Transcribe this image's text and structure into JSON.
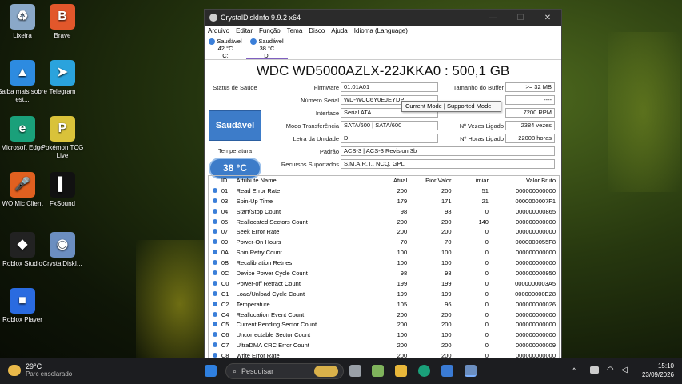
{
  "desktop": {
    "icons": [
      {
        "label": "Lixeira",
        "icon": "recycle-bin-icon",
        "color": "#8aa8c8",
        "glyph": "♻"
      },
      {
        "label": "Brave",
        "icon": "brave-icon",
        "color": "#e2572b",
        "glyph": "B"
      },
      {
        "label": "Saiba mais sobre est...",
        "icon": "learn-more-icon",
        "color": "#2d8be0",
        "glyph": "▲"
      },
      {
        "label": "Telegram",
        "icon": "telegram-icon",
        "color": "#2aa3dd",
        "glyph": "➤"
      },
      {
        "label": "Microsoft Edge",
        "icon": "edge-icon",
        "color": "#1aa07a",
        "glyph": "e"
      },
      {
        "label": "Pokémon TCG Live",
        "icon": "pokemon-icon",
        "color": "#d9c23a",
        "glyph": "P"
      },
      {
        "label": "WO Mic Client",
        "icon": "mic-icon",
        "color": "#e06020",
        "glyph": "🎤"
      },
      {
        "label": "FxSound",
        "icon": "fxsound-icon",
        "color": "#111111",
        "glyph": "▌"
      },
      {
        "label": "Roblox Studio",
        "icon": "roblox-studio-icon",
        "color": "#222222",
        "glyph": "◆"
      },
      {
        "label": "CrystalDiskI...",
        "icon": "crystaldisk-icon",
        "color": "#6b8ec0",
        "glyph": "◉"
      },
      {
        "label": "Roblox Player",
        "icon": "roblox-player-icon",
        "color": "#2a6be0",
        "glyph": "■"
      }
    ]
  },
  "window": {
    "title": "CrystalDiskInfo 9.9.2 x64",
    "controls": [
      "—",
      "☐",
      "✕"
    ],
    "menu": [
      "Arquivo",
      "Editar",
      "Função",
      "Tema",
      "Disco",
      "Ajuda",
      "Idioma (Language)"
    ],
    "drives": [
      {
        "status": "Saudável",
        "temp": "42 °C",
        "letter": "C:"
      },
      {
        "status": "Saudável",
        "temp": "38 °C",
        "letter": "D:"
      }
    ],
    "model": "WDC WD5000AZLX-22JKKA0 : 500,1 GB",
    "status_label": "Status de Saúde",
    "status_value": "Saudável",
    "temp_label": "Temperatura",
    "temp_value": "38 °C",
    "fields": {
      "firmware_label": "Firmware",
      "firmware": "01.01A01",
      "serial_label": "Número Serial",
      "serial": "WD-WCC6Y0EJEYDP",
      "interface_label": "Interface",
      "interface": "Serial ATA",
      "transfer_label": "Modo Transferência",
      "transfer": "SATA/600 | SATA/600",
      "letter_label": "Letra da Unidade",
      "letter": "D:",
      "standard_label": "Padrão",
      "standard": "ACS-3 | ACS-3 Revision 3b",
      "features_label": "Recursos Suportados",
      "features": "S.M.A.R.T., NCQ, GPL",
      "buffer_label": "Tamanho do Buffer",
      "buffer": ">= 32 MB",
      "blank1": "----",
      "blank2": "----",
      "rpm": "7200 RPM",
      "power_count_label": "Nº Vezes Ligado",
      "power_count": "2384 vezes",
      "power_hours_label": "Nº Horas Ligado",
      "power_hours": "22008 horas"
    },
    "tooltip": "Current Mode | Supported Mode",
    "table": {
      "headers": [
        "ID",
        "Attribute Name",
        "Atual",
        "Pior Valor",
        "Limiar",
        "Valor Bruto"
      ],
      "rows": [
        [
          "01",
          "Read Error Rate",
          "200",
          "200",
          "51",
          "000000000000"
        ],
        [
          "03",
          "Spin-Up Time",
          "179",
          "171",
          "21",
          "0000000007F1"
        ],
        [
          "04",
          "Start/Stop Count",
          "98",
          "98",
          "0",
          "000000000865"
        ],
        [
          "05",
          "Reallocated Sectors Count",
          "200",
          "200",
          "140",
          "000000000000"
        ],
        [
          "07",
          "Seek Error Rate",
          "200",
          "200",
          "0",
          "000000000000"
        ],
        [
          "09",
          "Power-On Hours",
          "70",
          "70",
          "0",
          "0000000055F8"
        ],
        [
          "0A",
          "Spin Retry Count",
          "100",
          "100",
          "0",
          "000000000000"
        ],
        [
          "0B",
          "Recalibration Retries",
          "100",
          "100",
          "0",
          "000000000000"
        ],
        [
          "0C",
          "Device Power Cycle Count",
          "98",
          "98",
          "0",
          "000000000950"
        ],
        [
          "C0",
          "Power-off Retract Count",
          "199",
          "199",
          "0",
          "0000000003A5"
        ],
        [
          "C1",
          "Load/Unload Cycle Count",
          "199",
          "199",
          "0",
          "000000000E28"
        ],
        [
          "C2",
          "Temperature",
          "105",
          "96",
          "0",
          "000000000026"
        ],
        [
          "C4",
          "Reallocation Event Count",
          "200",
          "200",
          "0",
          "000000000000"
        ],
        [
          "C5",
          "Current Pending Sector Count",
          "200",
          "200",
          "0",
          "000000000000"
        ],
        [
          "C6",
          "Uncorrectable Sector Count",
          "100",
          "100",
          "0",
          "000000000000"
        ],
        [
          "C7",
          "UltraDMA CRC Error Count",
          "200",
          "200",
          "0",
          "000000000009"
        ],
        [
          "C8",
          "Write Error Rate",
          "200",
          "200",
          "0",
          "000000000000"
        ]
      ]
    }
  },
  "taskbar": {
    "weather_temp": "29°C",
    "weather_desc": "Parc ensolarado",
    "search_placeholder": "Pesquisar",
    "time": "15:10",
    "date": "23/09/2026",
    "tray_icons": [
      "chevron-up-icon",
      "camera-icon",
      "wifi-icon",
      "volume-icon"
    ]
  },
  "colors": {
    "status_blue": "#3d7cc9",
    "dot_blue": "#3b7fd9",
    "taskbar_bg": "#1c1d20"
  }
}
